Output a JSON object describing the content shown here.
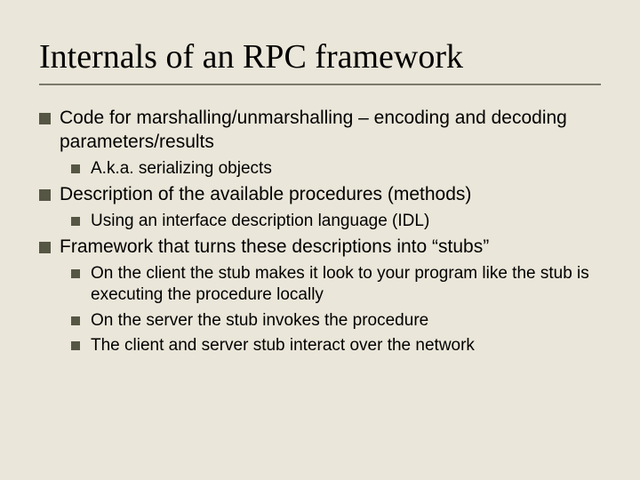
{
  "title": "Internals of an RPC framework",
  "items": [
    {
      "text": "Code for marshalling/unmarshalling – encoding and decoding parameters/results",
      "sub": [
        "A.k.a. serializing objects"
      ]
    },
    {
      "text": "Description of the available procedures (methods)",
      "sub": [
        "Using an interface description language (IDL)"
      ]
    },
    {
      "text": "Framework that turns these descriptions into “stubs”",
      "sub": [
        "On the client the stub makes it look to your program like the stub is executing the procedure locally",
        "On the server the stub invokes the procedure",
        "The client and server stub interact over the network"
      ]
    }
  ]
}
